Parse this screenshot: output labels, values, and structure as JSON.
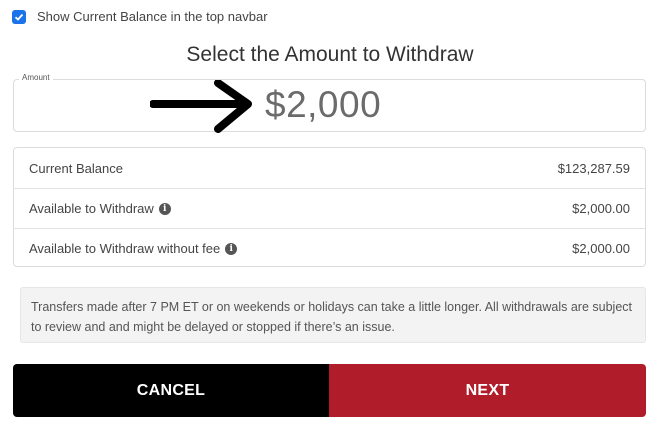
{
  "navbar_toggle": {
    "label": "Show Current Balance in the top navbar",
    "checked": true
  },
  "title": "Select the Amount to Withdraw",
  "amount": {
    "legend": "Amount",
    "value": "$2,000"
  },
  "balances": [
    {
      "label": "Current Balance",
      "value": "$123,287.59",
      "has_info": false
    },
    {
      "label": "Available to Withdraw",
      "value": "$2,000.00",
      "has_info": true
    },
    {
      "label": "Available to Withdraw without fee",
      "value": "$2,000.00",
      "has_info": true
    }
  ],
  "notice": "Transfers made after 7 PM ET or on weekends or holidays can take a little longer. All withdrawals are subject to review and and might be delayed or stopped if there’s an issue.",
  "buttons": {
    "cancel": "CANCEL",
    "next": "NEXT"
  },
  "colors": {
    "checkbox": "#1a73e8",
    "cancel": "#000000",
    "next": "#b01c2a"
  },
  "icons": {
    "arrow": "arrow-right-icon",
    "info": "info-icon",
    "check": "check-icon"
  }
}
